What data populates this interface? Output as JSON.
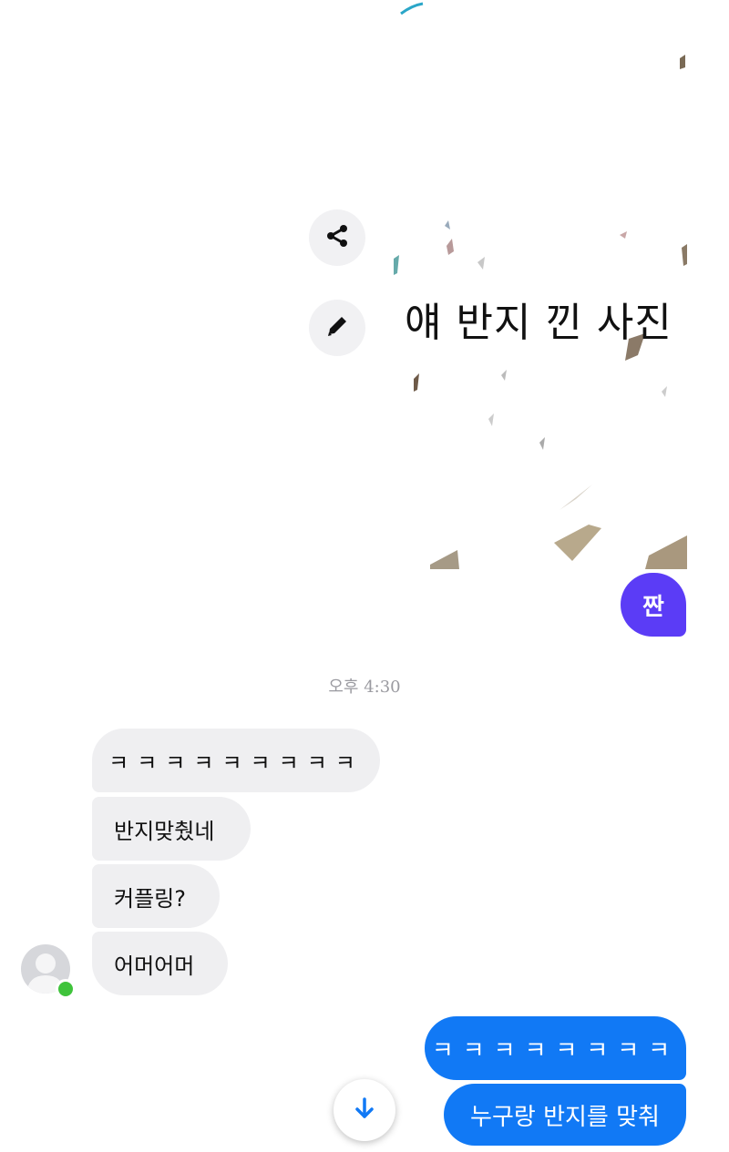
{
  "shared_photo": {
    "caption": "얘 반지 낀 사진"
  },
  "actions": {
    "share_icon": "share-icon",
    "edit_icon": "pencil-icon"
  },
  "sticker_reply": "짠",
  "timestamp": "오후 4:30",
  "incoming_messages": [
    "ㅋㅋㅋㅋㅋㅋㅋㅋㅋ",
    "반지맞췄네",
    "커플링?",
    "어머어머"
  ],
  "outgoing_messages": [
    "ㅋㅋㅋㅋㅋㅋㅋㅋ",
    "누구랑 반지를 맞춰"
  ],
  "colors": {
    "incoming_bubble": "#efeff1",
    "outgoing_bubble": "#1179f5",
    "sticker_bubble": "#5b3cf6",
    "online_indicator": "#3fc33b"
  }
}
